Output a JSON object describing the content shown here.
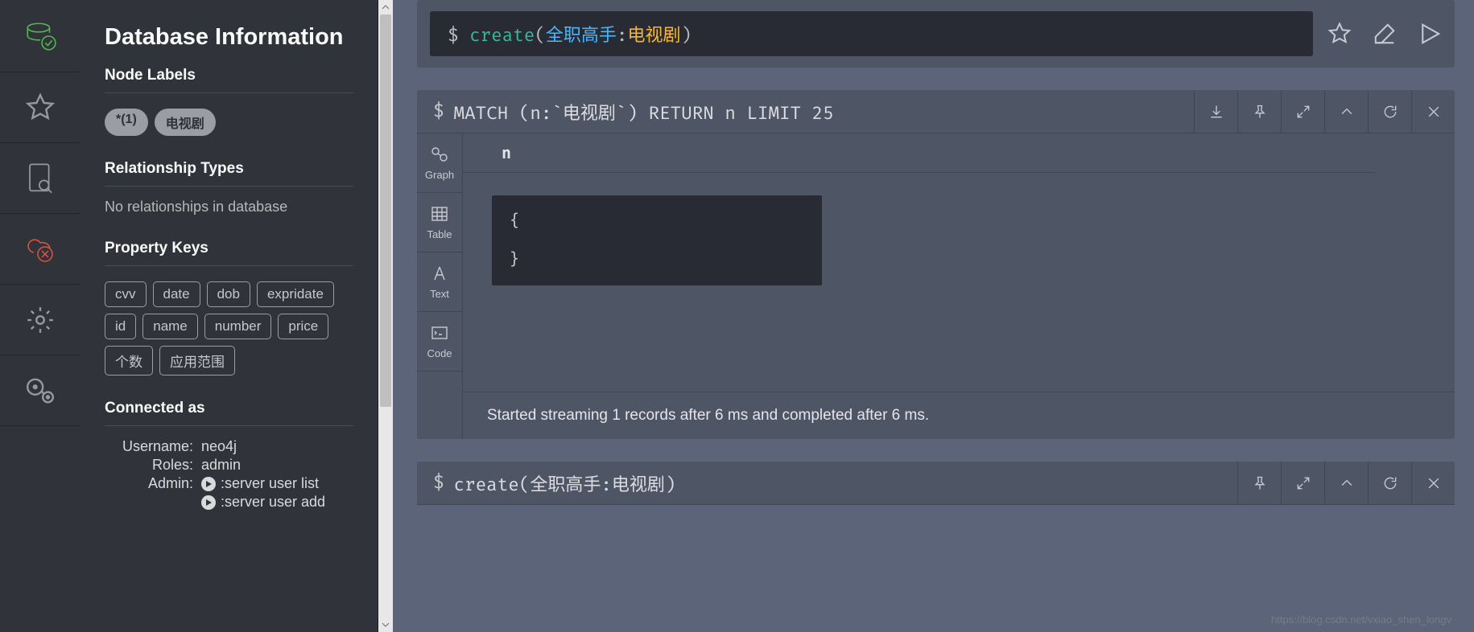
{
  "sidebar": {
    "title": "Database Information",
    "nodeLabels": {
      "heading": "Node Labels",
      "pills": [
        "*(1)",
        "电视剧"
      ]
    },
    "relTypes": {
      "heading": "Relationship Types",
      "empty_msg": "No relationships in database"
    },
    "propKeys": {
      "heading": "Property Keys",
      "keys": [
        "cvv",
        "date",
        "dob",
        "expridate",
        "id",
        "name",
        "number",
        "price",
        "个数",
        "应用范围"
      ]
    },
    "connected": {
      "heading": "Connected as",
      "username_label": "Username:",
      "username": "neo4j",
      "roles_label": "Roles:",
      "roles": "admin",
      "admin_label": "Admin:",
      "admin_cmds": [
        ":server user list",
        ":server user add"
      ]
    }
  },
  "editor": {
    "prompt": "$",
    "fn": "create",
    "lparen": "(",
    "ident": "全职高手",
    "colon": ":",
    "label": "电视剧",
    "rparen": ")"
  },
  "result1": {
    "prompt": "$",
    "query": "MATCH (n:`电视剧`) RETURN n LIMIT 25",
    "col_header": "n",
    "node_content": "{\n\n}",
    "footer": "Started streaming 1 records after 6 ms and completed after 6 ms.",
    "tabs": {
      "graph": "Graph",
      "table": "Table",
      "text": "Text",
      "code": "Code"
    }
  },
  "result2": {
    "prompt": "$",
    "query": "create(全职高手:电视剧)"
  },
  "watermark": "https://blog.csdn.net/vxiao_shen_longv"
}
